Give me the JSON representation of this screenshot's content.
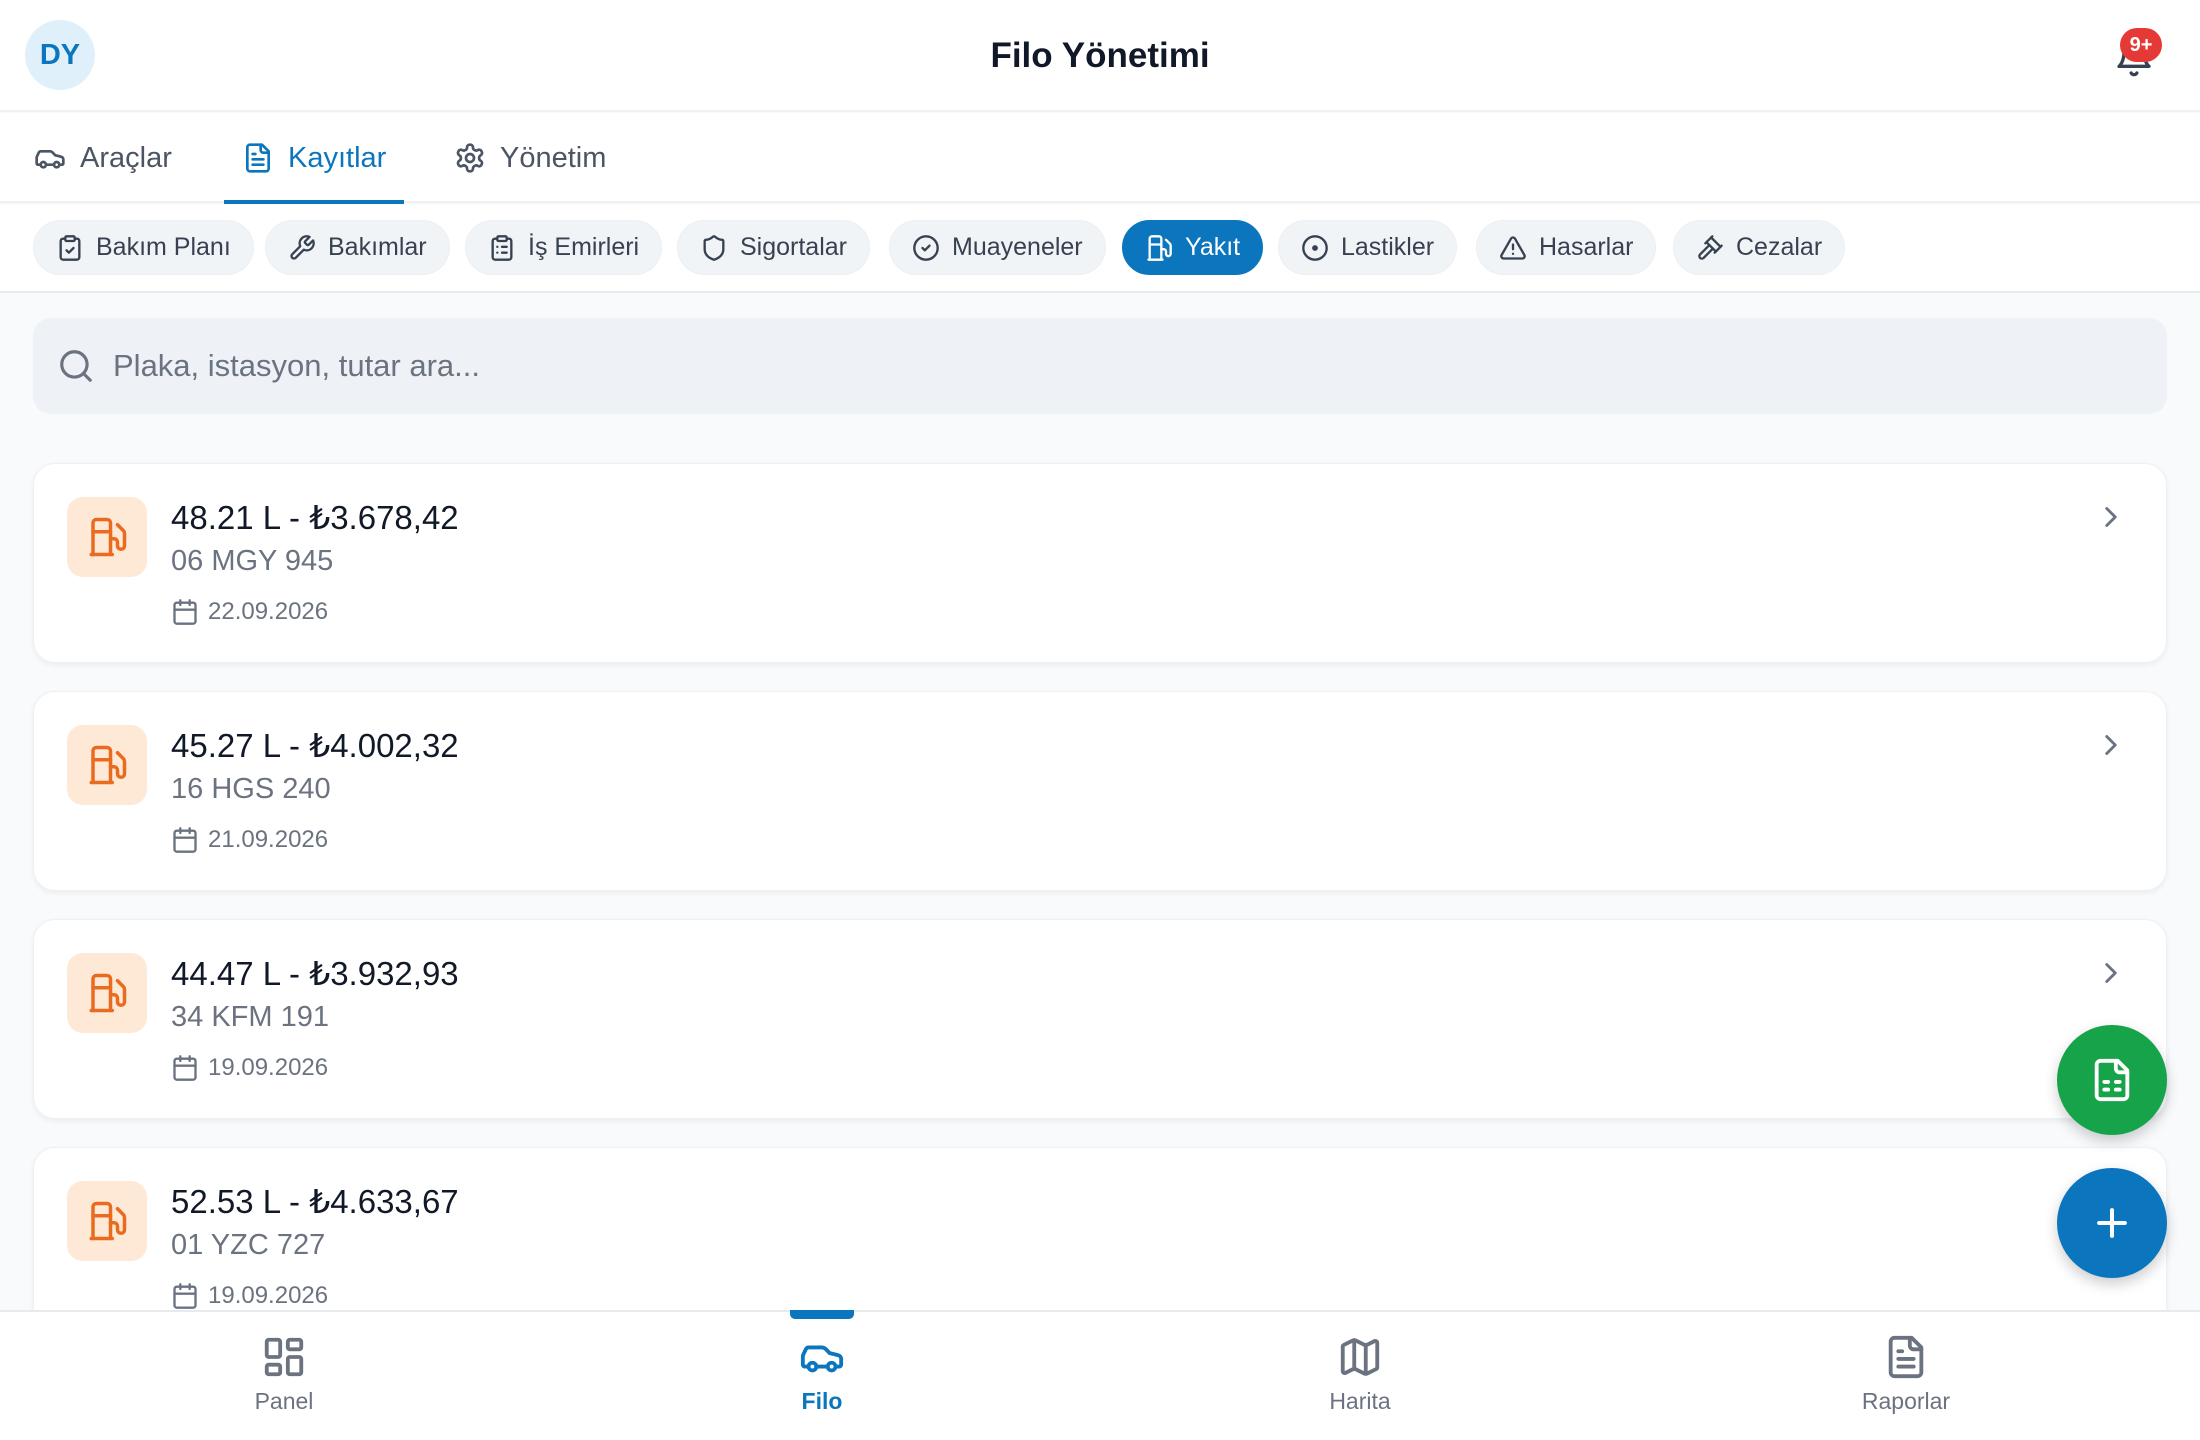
{
  "header": {
    "avatar_initials": "DY",
    "title": "Filo Yönetimi",
    "notification_count": "9+"
  },
  "tabs": [
    {
      "label": "Araçlar",
      "icon": "car-icon",
      "active": false
    },
    {
      "label": "Kayıtlar",
      "icon": "document-icon",
      "active": true
    },
    {
      "label": "Yönetim",
      "icon": "gear-icon",
      "active": false
    }
  ],
  "chips": [
    {
      "label": "Bakım Planı",
      "icon": "clipboard-check-icon",
      "active": false
    },
    {
      "label": "Bakımlar",
      "icon": "wrench-icon",
      "active": false
    },
    {
      "label": "İş Emirleri",
      "icon": "clipboard-list-icon",
      "active": false
    },
    {
      "label": "Sigortalar",
      "icon": "shield-icon",
      "active": false
    },
    {
      "label": "Muayeneler",
      "icon": "check-circle-icon",
      "active": false
    },
    {
      "label": "Yakıt",
      "icon": "fuel-icon",
      "active": true
    },
    {
      "label": "Lastikler",
      "icon": "tire-icon",
      "active": false
    },
    {
      "label": "Hasarlar",
      "icon": "warning-icon",
      "active": false
    },
    {
      "label": "Cezalar",
      "icon": "gavel-icon",
      "active": false
    }
  ],
  "search": {
    "placeholder": "Plaka, istasyon, tutar ara..."
  },
  "records": [
    {
      "title": "48.21 L - ₺3.678,42",
      "plate": "06 MGY 945",
      "date": "22.09.2026"
    },
    {
      "title": "45.27 L - ₺4.002,32",
      "plate": "16 HGS 240",
      "date": "21.09.2026"
    },
    {
      "title": "44.47 L - ₺3.932,93",
      "plate": "34 KFM 191",
      "date": "19.09.2026"
    },
    {
      "title": "52.53 L - ₺4.633,67",
      "plate": "01 YZC 727",
      "date": "19.09.2026"
    }
  ],
  "bottom_nav": [
    {
      "label": "Panel",
      "icon": "grid-icon",
      "active": false
    },
    {
      "label": "Filo",
      "icon": "car-icon",
      "active": true
    },
    {
      "label": "Harita",
      "icon": "map-icon",
      "active": false
    },
    {
      "label": "Raporlar",
      "icon": "report-icon",
      "active": false
    }
  ],
  "colors": {
    "primary": "#0b76bd",
    "fab_green": "#16a34a",
    "fuel_icon": "#ea6a1f",
    "fuel_icon_bg": "#fde9d6",
    "badge": "#e53935"
  }
}
